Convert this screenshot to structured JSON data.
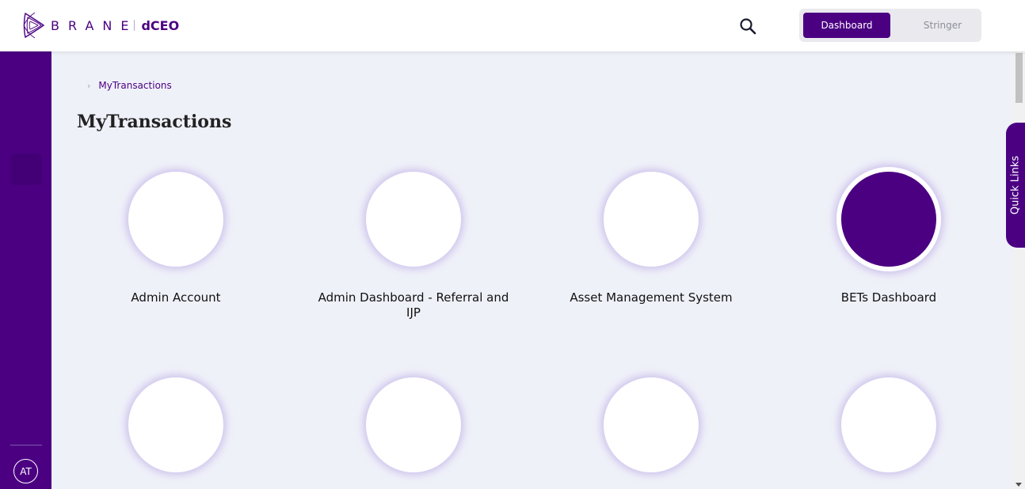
{
  "header": {
    "brand_name": "BRANE",
    "product_name": "dCEO",
    "search_label": "search",
    "toggle": {
      "active_label": "Dashboard",
      "inactive_label": "Stringer"
    }
  },
  "sidebar": {
    "avatar_initials": "AT"
  },
  "breadcrumb": {
    "current": "MyTransactions"
  },
  "page": {
    "title": "MyTransactions"
  },
  "apps": [
    {
      "label": "Admin Account",
      "selected": false
    },
    {
      "label": "Admin Dashboard - Referral and IJP",
      "selected": false
    },
    {
      "label": "Asset Management System",
      "selected": false
    },
    {
      "label": "BETs Dashboard",
      "selected": true
    },
    {
      "label": "",
      "selected": false
    },
    {
      "label": "",
      "selected": false
    },
    {
      "label": "",
      "selected": false
    },
    {
      "label": "",
      "selected": false
    }
  ],
  "quick_links": {
    "label": "Quick Links"
  },
  "colors": {
    "brand": "#4b0082",
    "background": "#eff1f9",
    "card_glow": "#8c64d2"
  }
}
